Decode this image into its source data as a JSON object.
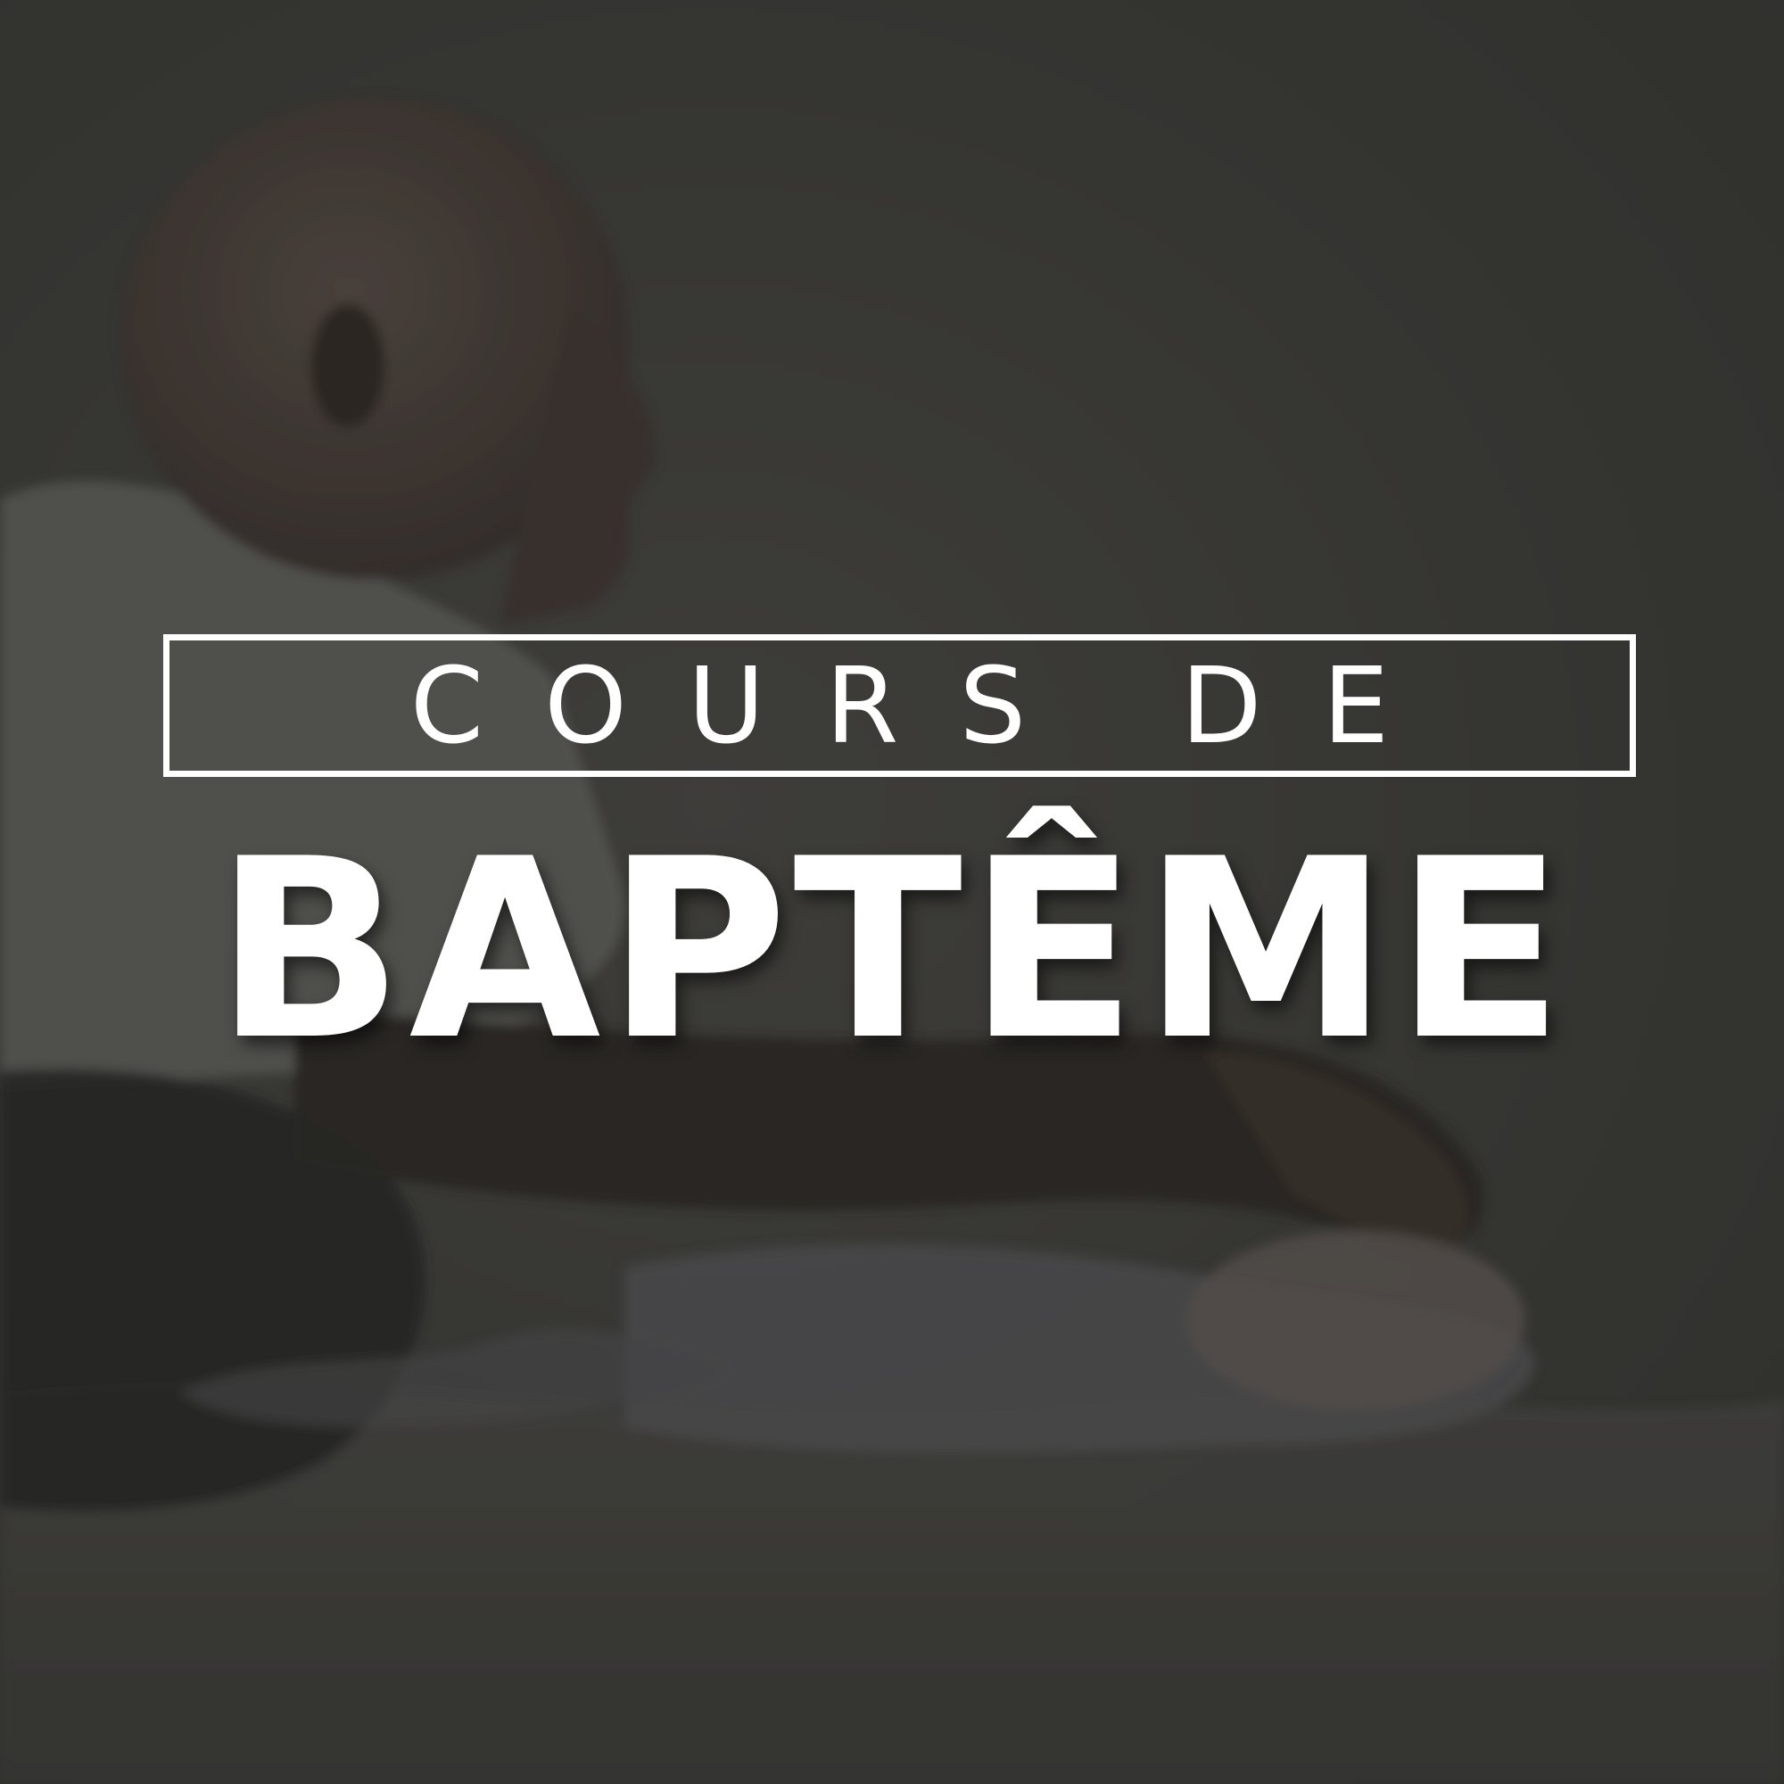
{
  "poster": {
    "subtitle": "COURS DE",
    "headline": "BAPTÊME"
  },
  "colors": {
    "background": "#3d3d3a",
    "text": "#ffffff",
    "frame": "#ffffff"
  },
  "icons": {
    "photo": "baptism-photo"
  }
}
